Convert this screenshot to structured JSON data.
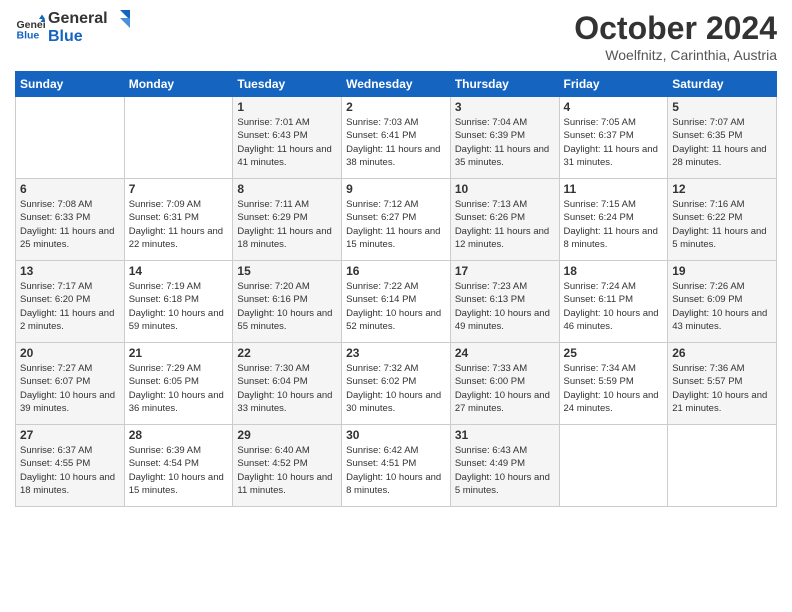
{
  "header": {
    "logo_general": "General",
    "logo_blue": "Blue",
    "month_title": "October 2024",
    "subtitle": "Woelfnitz, Carinthia, Austria"
  },
  "days_of_week": [
    "Sunday",
    "Monday",
    "Tuesday",
    "Wednesday",
    "Thursday",
    "Friday",
    "Saturday"
  ],
  "weeks": [
    [
      {
        "day": "",
        "content": ""
      },
      {
        "day": "",
        "content": ""
      },
      {
        "day": "1",
        "content": "Sunrise: 7:01 AM\nSunset: 6:43 PM\nDaylight: 11 hours and 41 minutes."
      },
      {
        "day": "2",
        "content": "Sunrise: 7:03 AM\nSunset: 6:41 PM\nDaylight: 11 hours and 38 minutes."
      },
      {
        "day": "3",
        "content": "Sunrise: 7:04 AM\nSunset: 6:39 PM\nDaylight: 11 hours and 35 minutes."
      },
      {
        "day": "4",
        "content": "Sunrise: 7:05 AM\nSunset: 6:37 PM\nDaylight: 11 hours and 31 minutes."
      },
      {
        "day": "5",
        "content": "Sunrise: 7:07 AM\nSunset: 6:35 PM\nDaylight: 11 hours and 28 minutes."
      }
    ],
    [
      {
        "day": "6",
        "content": "Sunrise: 7:08 AM\nSunset: 6:33 PM\nDaylight: 11 hours and 25 minutes."
      },
      {
        "day": "7",
        "content": "Sunrise: 7:09 AM\nSunset: 6:31 PM\nDaylight: 11 hours and 22 minutes."
      },
      {
        "day": "8",
        "content": "Sunrise: 7:11 AM\nSunset: 6:29 PM\nDaylight: 11 hours and 18 minutes."
      },
      {
        "day": "9",
        "content": "Sunrise: 7:12 AM\nSunset: 6:27 PM\nDaylight: 11 hours and 15 minutes."
      },
      {
        "day": "10",
        "content": "Sunrise: 7:13 AM\nSunset: 6:26 PM\nDaylight: 11 hours and 12 minutes."
      },
      {
        "day": "11",
        "content": "Sunrise: 7:15 AM\nSunset: 6:24 PM\nDaylight: 11 hours and 8 minutes."
      },
      {
        "day": "12",
        "content": "Sunrise: 7:16 AM\nSunset: 6:22 PM\nDaylight: 11 hours and 5 minutes."
      }
    ],
    [
      {
        "day": "13",
        "content": "Sunrise: 7:17 AM\nSunset: 6:20 PM\nDaylight: 11 hours and 2 minutes."
      },
      {
        "day": "14",
        "content": "Sunrise: 7:19 AM\nSunset: 6:18 PM\nDaylight: 10 hours and 59 minutes."
      },
      {
        "day": "15",
        "content": "Sunrise: 7:20 AM\nSunset: 6:16 PM\nDaylight: 10 hours and 55 minutes."
      },
      {
        "day": "16",
        "content": "Sunrise: 7:22 AM\nSunset: 6:14 PM\nDaylight: 10 hours and 52 minutes."
      },
      {
        "day": "17",
        "content": "Sunrise: 7:23 AM\nSunset: 6:13 PM\nDaylight: 10 hours and 49 minutes."
      },
      {
        "day": "18",
        "content": "Sunrise: 7:24 AM\nSunset: 6:11 PM\nDaylight: 10 hours and 46 minutes."
      },
      {
        "day": "19",
        "content": "Sunrise: 7:26 AM\nSunset: 6:09 PM\nDaylight: 10 hours and 43 minutes."
      }
    ],
    [
      {
        "day": "20",
        "content": "Sunrise: 7:27 AM\nSunset: 6:07 PM\nDaylight: 10 hours and 39 minutes."
      },
      {
        "day": "21",
        "content": "Sunrise: 7:29 AM\nSunset: 6:05 PM\nDaylight: 10 hours and 36 minutes."
      },
      {
        "day": "22",
        "content": "Sunrise: 7:30 AM\nSunset: 6:04 PM\nDaylight: 10 hours and 33 minutes."
      },
      {
        "day": "23",
        "content": "Sunrise: 7:32 AM\nSunset: 6:02 PM\nDaylight: 10 hours and 30 minutes."
      },
      {
        "day": "24",
        "content": "Sunrise: 7:33 AM\nSunset: 6:00 PM\nDaylight: 10 hours and 27 minutes."
      },
      {
        "day": "25",
        "content": "Sunrise: 7:34 AM\nSunset: 5:59 PM\nDaylight: 10 hours and 24 minutes."
      },
      {
        "day": "26",
        "content": "Sunrise: 7:36 AM\nSunset: 5:57 PM\nDaylight: 10 hours and 21 minutes."
      }
    ],
    [
      {
        "day": "27",
        "content": "Sunrise: 6:37 AM\nSunset: 4:55 PM\nDaylight: 10 hours and 18 minutes."
      },
      {
        "day": "28",
        "content": "Sunrise: 6:39 AM\nSunset: 4:54 PM\nDaylight: 10 hours and 15 minutes."
      },
      {
        "day": "29",
        "content": "Sunrise: 6:40 AM\nSunset: 4:52 PM\nDaylight: 10 hours and 11 minutes."
      },
      {
        "day": "30",
        "content": "Sunrise: 6:42 AM\nSunset: 4:51 PM\nDaylight: 10 hours and 8 minutes."
      },
      {
        "day": "31",
        "content": "Sunrise: 6:43 AM\nSunset: 4:49 PM\nDaylight: 10 hours and 5 minutes."
      },
      {
        "day": "",
        "content": ""
      },
      {
        "day": "",
        "content": ""
      }
    ]
  ]
}
